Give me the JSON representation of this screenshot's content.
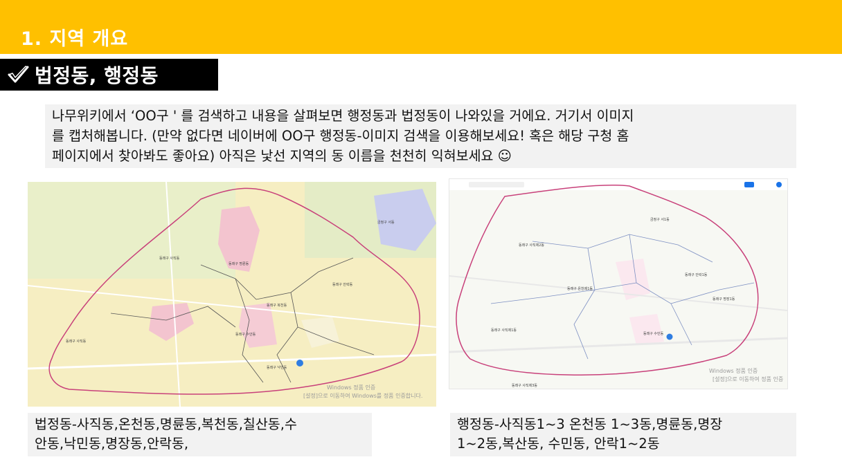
{
  "header": {
    "title": "1. 지역 개요"
  },
  "section": {
    "label": "법정동, 행정동",
    "icon": "check-icon"
  },
  "intro": {
    "line1": "나무위키에서 ‘OO구 ' 를 검색하고 내용을 살펴보면 행정동과 법정동이 나와있을 거에요. 거기서 이미지",
    "line2": "를 캡처해봅니다. (만약 없다면 네이버에 OO구 행정동-이미지 검색을 이용해보세요! 혹은 해당 구청 홈",
    "line3": "페이지에서 찾아봐도 좋아요) 아직은 낯선 지역의 동 이름을 천천히 익혀보세요 ☺"
  },
  "maps": {
    "left": {
      "watermark_1": "Windows 정품 인증",
      "watermark_2": "[설정]으로 이동하여 Windows를 정품 인증합니다."
    },
    "right": {
      "watermark_1": "Windows 정품 인증",
      "watermark_2": "[설정]으로 이동하여 정품 인증"
    }
  },
  "captions": {
    "left": {
      "line1": "법정동-사직동,온천동,명륜동,복천동,칠산동,수",
      "line2": "안동,낙민동,명장동,안락동,"
    },
    "right": {
      "line1": "행정동-사직동1~3 온천동 1~3동,명륜동,명장",
      "line2": "1~2동,복산동, 수민동, 안락1~2동"
    }
  },
  "colors": {
    "banner": "#ffc000",
    "tag_bg": "#000000",
    "box_bg": "#f2f2f2",
    "boundary": "#c8407a"
  }
}
